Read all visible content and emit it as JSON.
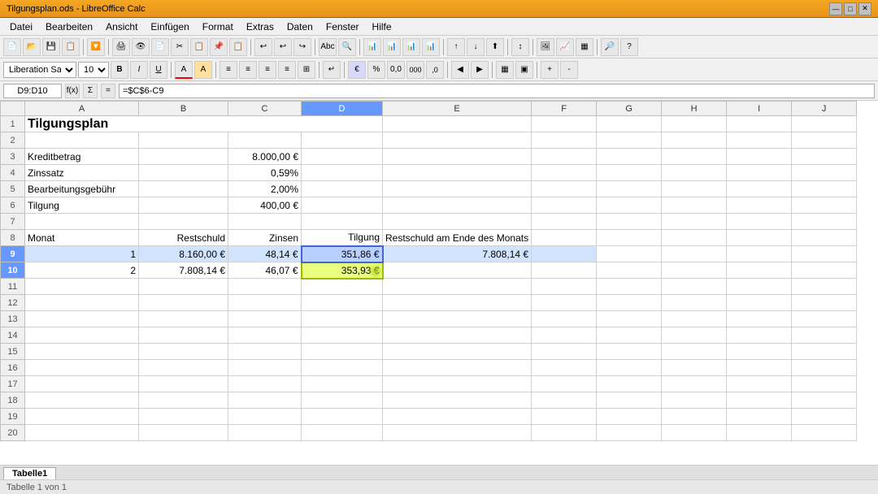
{
  "titlebar": {
    "title": "Tilgungsplan.ods - LibreOffice Calc",
    "controls": [
      "—",
      "□",
      "✕"
    ]
  },
  "menubar": {
    "items": [
      "Datei",
      "Bearbeiten",
      "Ansicht",
      "Einfügen",
      "Format",
      "Extras",
      "Daten",
      "Fenster",
      "Hilfe"
    ]
  },
  "formulabar": {
    "cell_ref": "D9:D10",
    "formula": "=$C$6-C9"
  },
  "font_name": "Liberation Sans",
  "font_size": "10",
  "tabs": [
    "Tabelle1"
  ],
  "col_headers": [
    "",
    "A",
    "B",
    "C",
    "D",
    "E",
    "F",
    "G",
    "H",
    "I",
    "J"
  ],
  "rows": [
    {
      "row": 1,
      "cells": {
        "A": {
          "v": "Tilgungsplan",
          "style": "large bold"
        }
      }
    },
    {
      "row": 2,
      "cells": {}
    },
    {
      "row": 3,
      "cells": {
        "A": {
          "v": "Kreditbetrag"
        },
        "C": {
          "v": "8.000,00 €",
          "style": "text-right green-bg"
        }
      }
    },
    {
      "row": 4,
      "cells": {
        "A": {
          "v": "Zinssatz"
        },
        "C": {
          "v": "0,59%",
          "style": "text-right green-bg"
        }
      }
    },
    {
      "row": 5,
      "cells": {
        "A": {
          "v": "Bearbeitungsgebühr"
        },
        "C": {
          "v": "2,00%",
          "style": "text-right green-bg"
        }
      }
    },
    {
      "row": 6,
      "cells": {
        "A": {
          "v": "Tilgung"
        },
        "C": {
          "v": "400,00 €",
          "style": "text-right"
        }
      }
    },
    {
      "row": 7,
      "cells": {}
    },
    {
      "row": 8,
      "cells": {
        "A": {
          "v": "Monat"
        },
        "B": {
          "v": "Restschuld"
        },
        "C": {
          "v": "Zinsen"
        },
        "D": {
          "v": "Tilgung"
        },
        "E": {
          "v": "Restschuld am Ende des Monats"
        }
      }
    },
    {
      "row": 9,
      "cells": {
        "A": {
          "v": "1",
          "style": "text-right row9"
        },
        "B": {
          "v": "8.160,00 €",
          "style": "text-right row9"
        },
        "C": {
          "v": "48,14 €",
          "style": "text-right row9"
        },
        "D": {
          "v": "351,86 €",
          "style": "text-right selected row9"
        },
        "E": {
          "v": "7.808,14 €",
          "style": "text-right row9"
        }
      }
    },
    {
      "row": 10,
      "cells": {
        "A": {
          "v": "2",
          "style": "text-right row10"
        },
        "B": {
          "v": "7.808,14 €",
          "style": "text-right row10"
        },
        "C": {
          "v": "46,07 €",
          "style": "text-right row10"
        },
        "D": {
          "v": "353,93 €",
          "style": "text-right selected row10"
        }
      }
    },
    {
      "row": 11,
      "cells": {}
    },
    {
      "row": 12,
      "cells": {}
    },
    {
      "row": 13,
      "cells": {}
    },
    {
      "row": 14,
      "cells": {}
    },
    {
      "row": 15,
      "cells": {}
    },
    {
      "row": 16,
      "cells": {}
    },
    {
      "row": 17,
      "cells": {}
    },
    {
      "row": 18,
      "cells": {}
    },
    {
      "row": 19,
      "cells": {}
    },
    {
      "row": 20,
      "cells": {}
    }
  ],
  "statusbar": {
    "sheet": "Tabelle 1 von 1",
    "info": ""
  }
}
